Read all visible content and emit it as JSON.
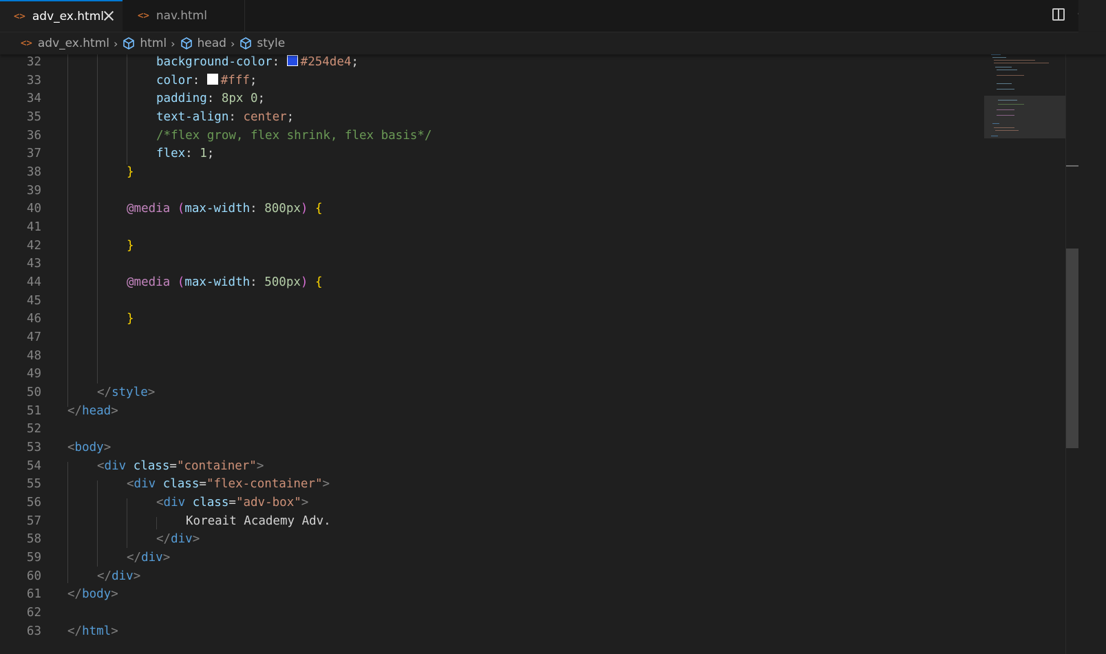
{
  "tabs": [
    {
      "label": "adv_ex.html",
      "active": true
    },
    {
      "label": "nav.html",
      "active": false
    }
  ],
  "breadcrumb": [
    "adv_ex.html",
    "html",
    "head",
    "style"
  ],
  "colors": {
    "accent": "#0078d4",
    "html_icon": "#e37933",
    "swatch_bg": "#254de4",
    "swatch_color": "#ffffff"
  },
  "icons": {
    "split": "split-editor-icon",
    "more": "more-actions-icon"
  },
  "code": {
    "l32": {
      "num": "32",
      "prop": "background-color",
      "val": "#254de4"
    },
    "l33": {
      "num": "33",
      "prop": "color",
      "val": "#fff"
    },
    "l34": {
      "num": "34",
      "prop": "padding",
      "val1": "8px",
      "val2": "0"
    },
    "l35": {
      "num": "35",
      "prop": "text-align",
      "val": "center"
    },
    "l36": {
      "num": "36",
      "comment": "/*flex grow, flex shrink, flex basis*/"
    },
    "l37": {
      "num": "37",
      "prop": "flex",
      "val": "1"
    },
    "l38": {
      "num": "38",
      "brace": "}"
    },
    "l39": {
      "num": "39"
    },
    "l40": {
      "num": "40",
      "at": "@media",
      "feature": "max-width",
      "value": "800px",
      "brace": "{"
    },
    "l41": {
      "num": "41"
    },
    "l42": {
      "num": "42",
      "brace": "}"
    },
    "l43": {
      "num": "43"
    },
    "l44": {
      "num": "44",
      "at": "@media",
      "feature": "max-width",
      "value": "500px",
      "brace": "{"
    },
    "l45": {
      "num": "45"
    },
    "l46": {
      "num": "46",
      "brace": "}"
    },
    "l47": {
      "num": "47"
    },
    "l48": {
      "num": "48"
    },
    "l49": {
      "num": "49"
    },
    "l50": {
      "num": "50",
      "tag": "style"
    },
    "l51": {
      "num": "51",
      "tag": "head"
    },
    "l52": {
      "num": "52"
    },
    "l53": {
      "num": "53",
      "tag": "body"
    },
    "l54": {
      "num": "54",
      "tag": "div",
      "attr": "class",
      "value": "\"container\""
    },
    "l55": {
      "num": "55",
      "tag": "div",
      "attr": "class",
      "value": "\"flex-container\""
    },
    "l56": {
      "num": "56",
      "tag": "div",
      "attr": "class",
      "value": "\"adv-box\""
    },
    "l57": {
      "num": "57",
      "text": "Koreait Academy Adv."
    },
    "l58": {
      "num": "58",
      "tag": "div"
    },
    "l59": {
      "num": "59",
      "tag": "div"
    },
    "l60": {
      "num": "60",
      "tag": "div"
    },
    "l61": {
      "num": "61",
      "tag": "body"
    },
    "l62": {
      "num": "62"
    },
    "l63": {
      "num": "63",
      "tag": "html"
    }
  }
}
